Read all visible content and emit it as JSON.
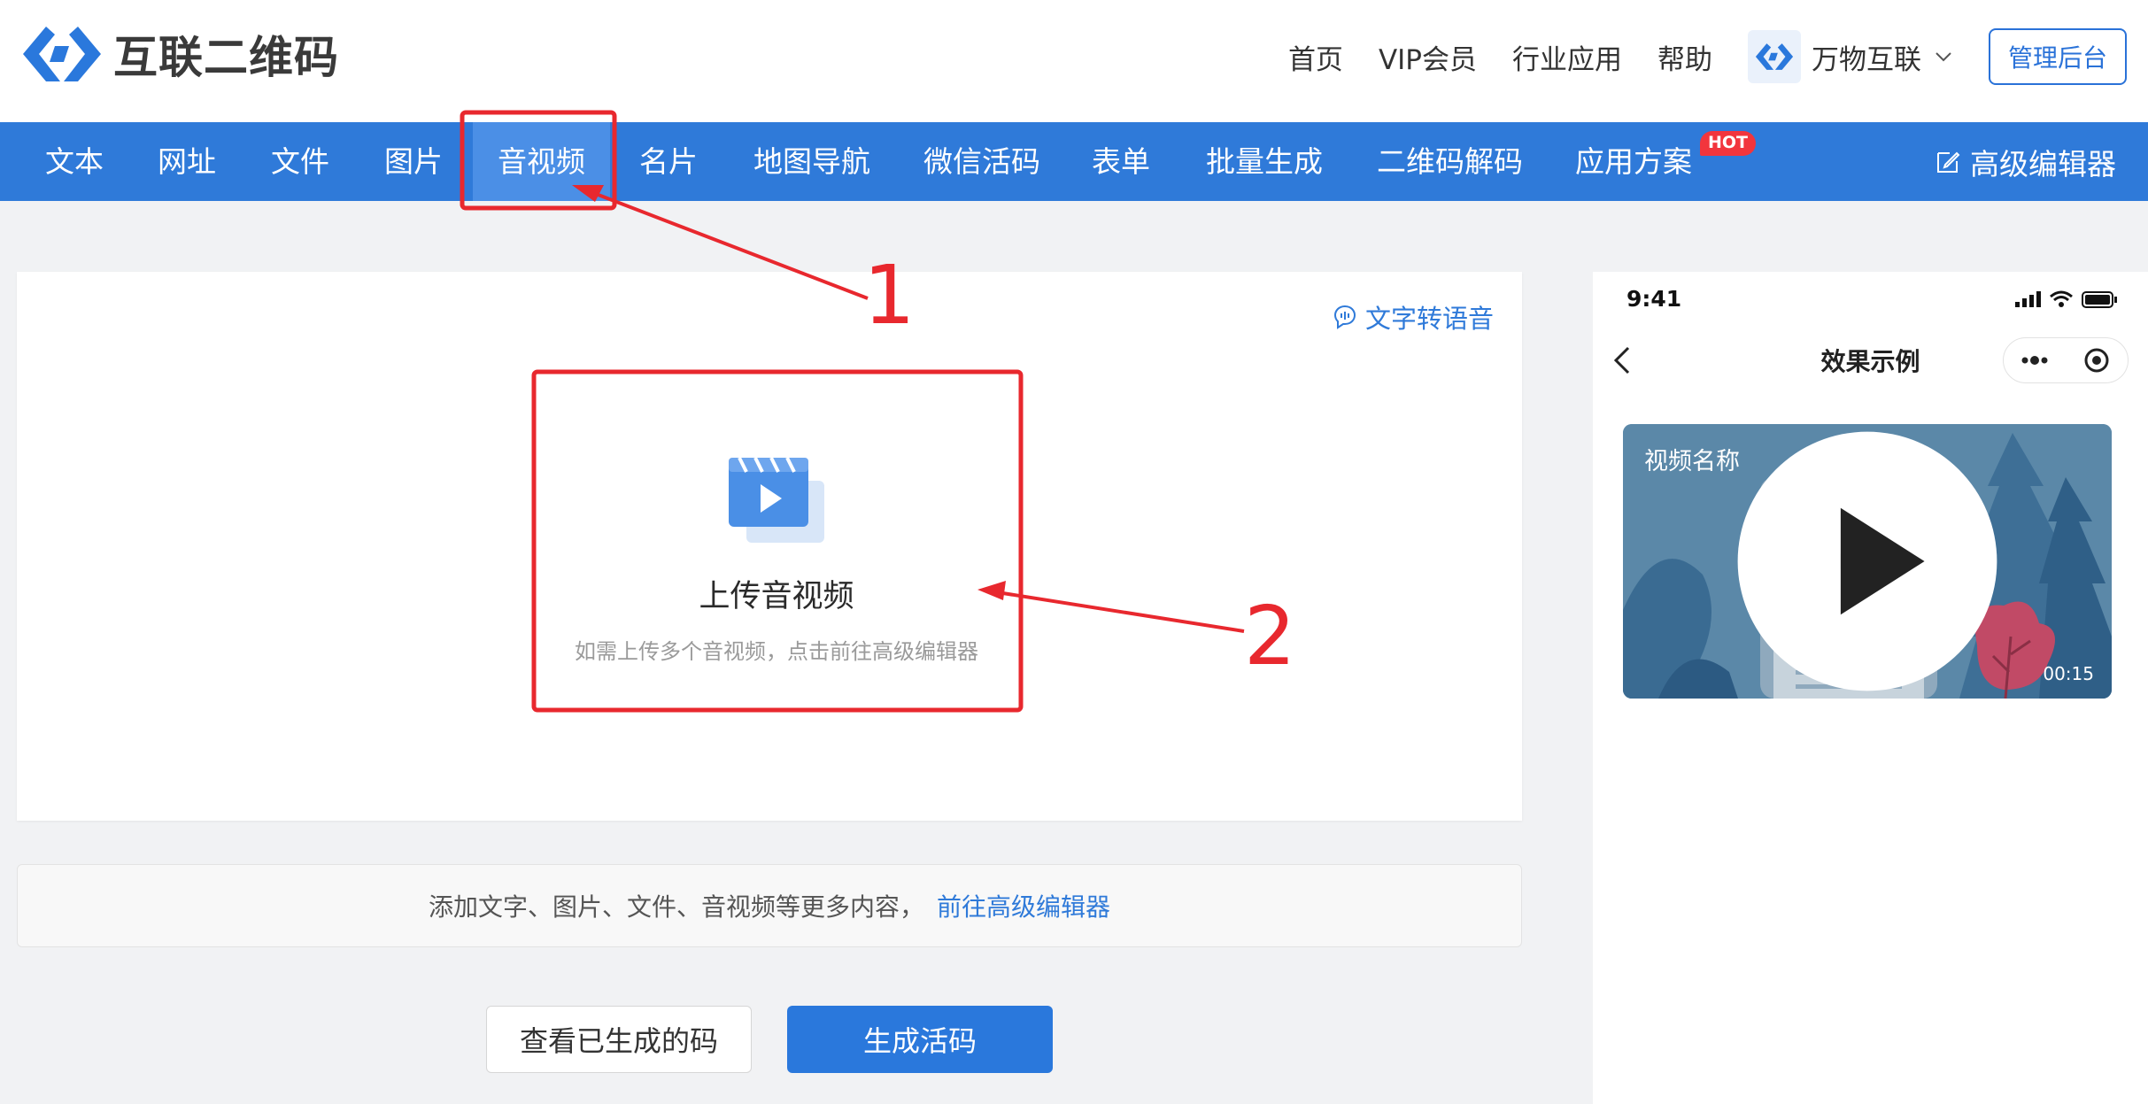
{
  "header": {
    "logo_text": "互联二维码",
    "nav": [
      "首页",
      "VIP会员",
      "行业应用",
      "帮助"
    ],
    "org_name": "万物互联",
    "admin_label": "管理后台"
  },
  "main_nav": {
    "tabs": [
      "文本",
      "网址",
      "文件",
      "图片",
      "音视频",
      "名片",
      "地图导航",
      "微信活码",
      "表单",
      "批量生成",
      "二维码解码",
      "应用方案"
    ],
    "active": "音视频",
    "hot_badge": "HOT",
    "advanced_editor": "高级编辑器"
  },
  "upload": {
    "tts_label": "文字转语音",
    "title": "上传音视频",
    "hint": "如需上传多个音视频，点击前往高级编辑器"
  },
  "infobar": {
    "text": "添加文字、图片、文件、音视频等更多内容，",
    "link": "前往高级编辑器"
  },
  "actions": {
    "view_label": "查看已生成的码",
    "generate_label": "生成活码"
  },
  "phone": {
    "time": "9:41",
    "title": "效果示例",
    "video_name": "视频名称",
    "duration": "00:15"
  },
  "annotations": [
    "1",
    "2"
  ],
  "colors": {
    "primary": "#2f7ad9",
    "annotation": "#e8282e",
    "hot": "#f2353d"
  }
}
